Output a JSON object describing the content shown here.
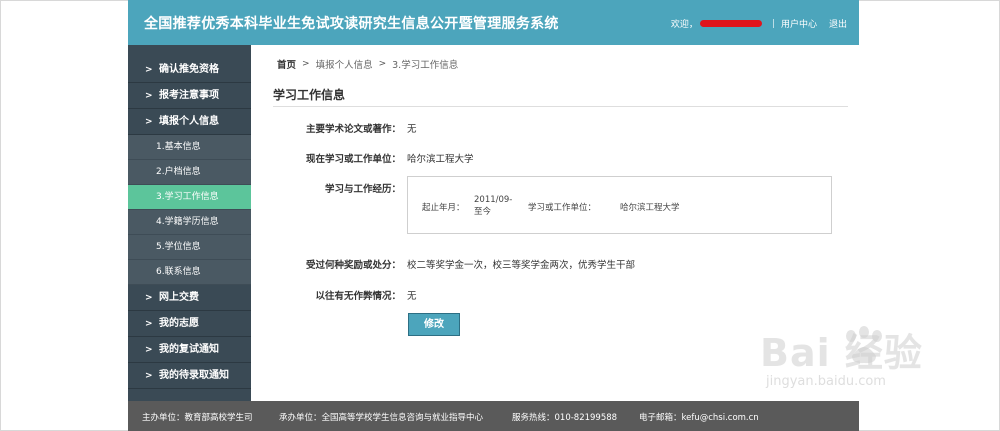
{
  "header": {
    "title": "全国推荐优秀本科毕业生免试攻读研究生信息公开暨管理服务系统",
    "welcome": "欢迎，",
    "user_center": "用户中心",
    "sep": "|",
    "logout": "退出"
  },
  "sidebar": {
    "items": [
      {
        "label": "确认推免资格"
      },
      {
        "label": "报考注意事项"
      },
      {
        "label": "填报个人信息"
      }
    ],
    "sub_items": [
      {
        "label": "1.基本信息"
      },
      {
        "label": "2.户档信息"
      },
      {
        "label": "3.学习工作信息"
      },
      {
        "label": "4.学籍学历信息"
      },
      {
        "label": "5.学位信息"
      },
      {
        "label": "6.联系信息"
      }
    ],
    "items_after": [
      {
        "label": "网上交费"
      },
      {
        "label": "我的志愿"
      },
      {
        "label": "我的复试通知"
      },
      {
        "label": "我的待录取通知"
      }
    ],
    "arrow": ">"
  },
  "breadcrumb": {
    "home": "首页",
    "level2": "填报个人信息",
    "level3": "3.学习工作信息",
    "chevron": ">"
  },
  "section_title": "学习工作信息",
  "form": {
    "thesis_label": "主要学术论文或著作：",
    "thesis_value": "无",
    "unit_label": "现在学习或工作单位：",
    "unit_value": "哈尔滨工程大学",
    "experience_label": "学习与工作经历：",
    "experience": {
      "start_label": "起止年月：",
      "date_line1": "2011/09-",
      "date_line2": "至今",
      "unit_label": "学习或工作单位：",
      "unit_value": "哈尔滨工程大学"
    },
    "awards_label": "受过何种奖励或处分：",
    "awards_value": "校二等奖学金一次，校三等奖学金两次，优秀学生干部",
    "cheating_label": "以往有无作弊情况：",
    "cheating_value": "无",
    "edit_button": "修改"
  },
  "footer": {
    "sponsor": "主办单位：教育部高校学生司",
    "organizer": "承办单位：全国高等学校学生信息咨询与就业指导中心",
    "hotline": "服务热线：010-82199588",
    "email": "电子邮箱：kefu@chsi.com.cn"
  },
  "watermark": {
    "brand": "Bai  经验",
    "url": "jingyan.baidu.com"
  },
  "colors": {
    "header_bg": "#4ca5bc",
    "sidebar_bg": "#3a4a55",
    "sidebar_active": "#5cc59b",
    "footer_bg": "#5a5a5a",
    "redaction": "#e0141c"
  }
}
